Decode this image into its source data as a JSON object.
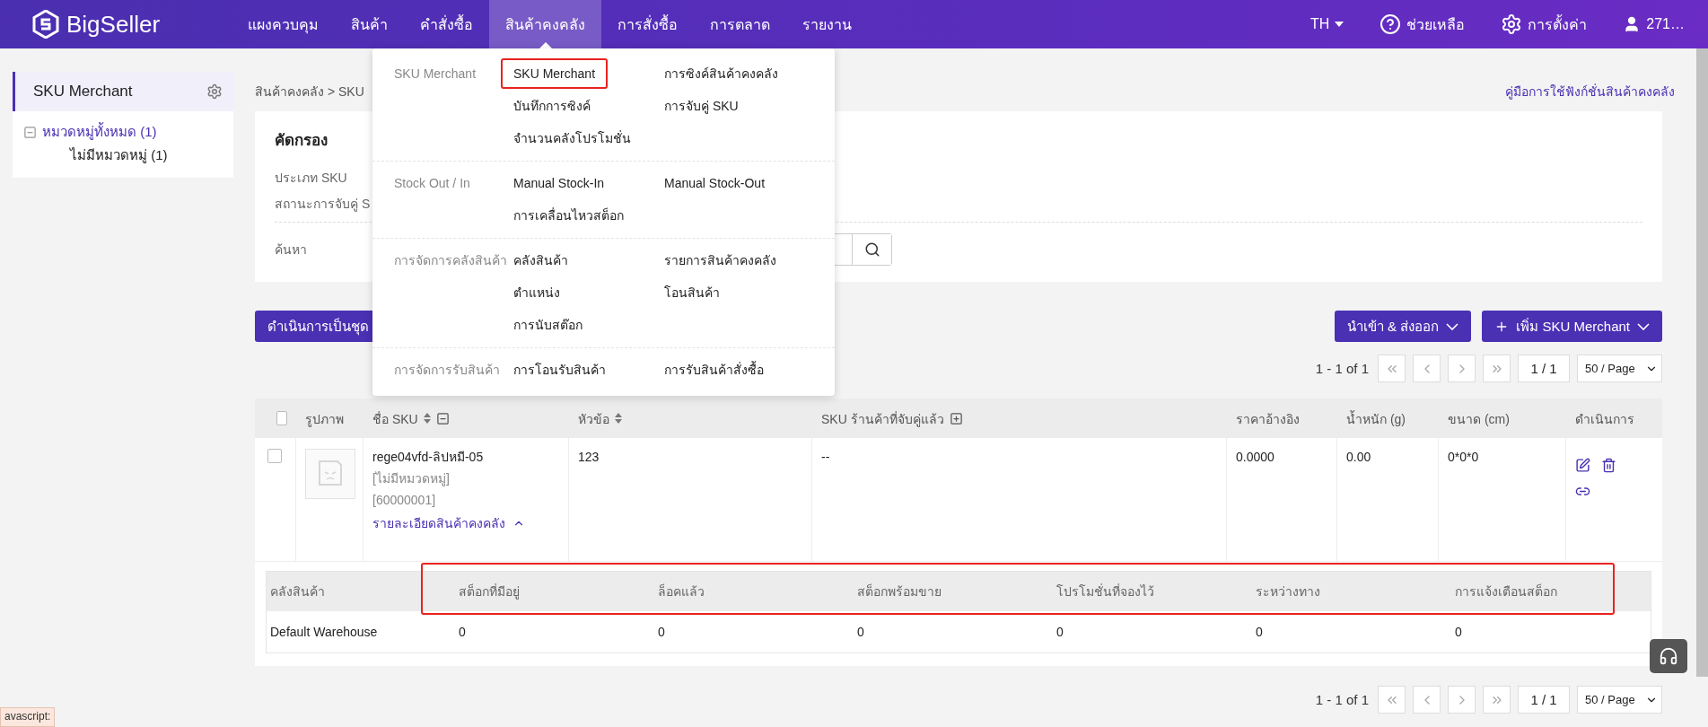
{
  "brand": "BigSeller",
  "nav": [
    {
      "label": "แผงควบคุม",
      "selected": false
    },
    {
      "label": "สินค้า",
      "selected": false
    },
    {
      "label": "คำสั่งซื้อ",
      "selected": false
    },
    {
      "label": "สินค้าคงคลัง",
      "selected": true
    },
    {
      "label": "การสั่งซื้อ",
      "selected": false
    },
    {
      "label": "การตลาด",
      "selected": false
    },
    {
      "label": "รายงาน",
      "selected": false
    }
  ],
  "top_right": {
    "language": "TH",
    "help": "ช่วยเหลือ",
    "settings": "การตั้งค่า",
    "user": "271…"
  },
  "sidebar": {
    "title": "SKU Merchant",
    "tree": [
      {
        "label": "หมวดหมู่ทั้งหมด (1)",
        "expanded": true,
        "selected": true,
        "children": [
          {
            "label": "ไม่มีหมวดหมู่ (1)",
            "selected": false
          }
        ]
      }
    ]
  },
  "breadcrumb": {
    "items": [
      "สินค้าคงคลัง",
      "SKU"
    ],
    "separator": ">"
  },
  "help_link": "คู่มือการใช้ฟังก์ชั่นสินค้าคงคลัง",
  "filter": {
    "title": "คัดกรอง",
    "rows": [
      "ประเภท SKU",
      "สถานะการจับคู่ S"
    ],
    "search_label": "ค้นหา"
  },
  "toolbar": {
    "bulk_button": "ดำเนินการเป็นชุด",
    "import_export": "นำเข้า & ส่งออก",
    "add": "เพิ่ม SKU Merchant"
  },
  "pagination": [
    {
      "summary": "1 - 1 of 1",
      "page": "1 / 1",
      "page_size": "50 / Page"
    },
    {
      "summary": "1 - 1 of 1",
      "page": "1 / 1",
      "page_size": "50 / Page"
    }
  ],
  "table": {
    "header_checked": false,
    "columns": [
      {
        "label": "รูปภาพ",
        "sortable": false
      },
      {
        "label": "ชื่อ SKU",
        "sortable": true,
        "expanded": true
      },
      {
        "label": "หัวข้อ",
        "sortable": true
      },
      {
        "label": "SKU ร้านค้าที่จับคู่แล้ว",
        "sortable": false,
        "expanded": false
      },
      {
        "label": "ราคาอ้างอิง",
        "sortable": false
      },
      {
        "label": "น้ำหนัก (g)",
        "sortable": false
      },
      {
        "label": "ขนาด (cm)",
        "sortable": false
      },
      {
        "label": "ดำเนินการ",
        "sortable": false
      }
    ],
    "rows": [
      {
        "checked": false,
        "name": "rege04vfd-ลิปหมี-05",
        "category": "[ไม่มีหมวดหมู่]",
        "code": "[60000001]",
        "detail_link": "รายละเอียดสินค้าคงคลัง",
        "expanded": true,
        "title": "123",
        "matched": "--",
        "price": "0.0000",
        "weight": "0.00",
        "size": "0*0*0",
        "stock": {
          "highlighted": true,
          "columns": [
            "คลังสินค้า",
            "สต็อกที่มีอยู่",
            "ล็อคแล้ว",
            "สต็อกพร้อมขาย",
            "โปรโมชั่นที่จองไว้",
            "ระหว่างทาง",
            "การแจ้งเตือนสต็อก"
          ],
          "rows": [
            [
              "Default Warehouse",
              "0",
              "0",
              "0",
              "0",
              "0",
              "0"
            ]
          ]
        }
      }
    ]
  },
  "menu": {
    "groups": [
      {
        "title": "SKU Merchant",
        "items": [
          {
            "label": "SKU Merchant",
            "highlighted": true
          },
          {
            "label": "การซิงค์สินค้าคงคลัง",
            "highlighted": false
          },
          {
            "label": "บันทึกการซิงค์",
            "highlighted": false
          },
          {
            "label": "การจับคู่ SKU",
            "highlighted": false
          },
          {
            "label": "จำนวนคลังโปรโมชั่น",
            "highlighted": false
          }
        ]
      },
      {
        "title": "Stock Out / In",
        "items": [
          {
            "label": "Manual Stock-In",
            "highlighted": false
          },
          {
            "label": "Manual Stock-Out",
            "highlighted": false
          },
          {
            "label": "การเคลื่อนไหวสต็อก",
            "highlighted": false
          }
        ]
      },
      {
        "title": "การจัดการคลังสินค้า",
        "items": [
          {
            "label": "คลังสินค้า",
            "highlighted": false
          },
          {
            "label": "รายการสินค้าคงคลัง",
            "highlighted": false
          },
          {
            "label": "ตำแหน่ง",
            "highlighted": false
          },
          {
            "label": "โอนสินค้า",
            "highlighted": false
          },
          {
            "label": "การนับสต๊อก",
            "highlighted": false
          }
        ]
      },
      {
        "title": "การจัดการรับสินค้า",
        "items": [
          {
            "label": "การโอนรับสินค้า",
            "highlighted": false
          },
          {
            "label": "การรับสินค้าสั่งซื้อ",
            "highlighted": false
          }
        ]
      }
    ]
  },
  "status_bar": "avascript:"
}
